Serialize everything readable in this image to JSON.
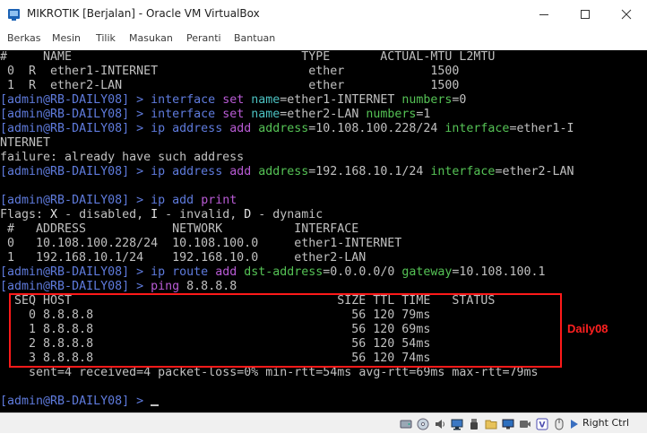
{
  "window": {
    "title": "MIKROTIK [Berjalan] - Oracle VM VirtualBox",
    "menu": [
      "Berkas",
      "Mesin",
      "Tilik",
      "Masukan",
      "Peranti",
      "Bantuan"
    ]
  },
  "terminal": {
    "lines": [
      [
        [
          "#     NAME                                TYPE       ACTUAL-MTU L2MTU",
          "w"
        ]
      ],
      [
        [
          " 0  R  ether1-INTERNET                     ether            1500",
          "w"
        ]
      ],
      [
        [
          " 1  R  ether2-LAN                          ether            1500",
          "w"
        ]
      ],
      [
        [
          "[admin@",
          "blue"
        ],
        [
          "RB-DAILY08",
          "blue"
        ],
        [
          "] > ",
          "blue"
        ],
        [
          "interface ",
          "blue"
        ],
        [
          "set ",
          "mag"
        ],
        [
          "name",
          "cyan"
        ],
        [
          "=ether1-INTERNET ",
          "w"
        ],
        [
          "numbers",
          "green"
        ],
        [
          "=0",
          "w"
        ]
      ],
      [
        [
          "[admin@",
          "blue"
        ],
        [
          "RB-DAILY08",
          "blue"
        ],
        [
          "] > ",
          "blue"
        ],
        [
          "interface ",
          "blue"
        ],
        [
          "set ",
          "mag"
        ],
        [
          "name",
          "cyan"
        ],
        [
          "=ether2-LAN ",
          "w"
        ],
        [
          "numbers",
          "green"
        ],
        [
          "=1",
          "w"
        ]
      ],
      [
        [
          "[admin@",
          "blue"
        ],
        [
          "RB-DAILY08",
          "blue"
        ],
        [
          "] > ",
          "blue"
        ],
        [
          "ip address ",
          "blue"
        ],
        [
          "add ",
          "mag"
        ],
        [
          "address",
          "green"
        ],
        [
          "=10.108.100.228/24 ",
          "w"
        ],
        [
          "interface",
          "green"
        ],
        [
          "=ether1-I",
          "w"
        ]
      ],
      [
        [
          "NTERNET",
          "w"
        ]
      ],
      [
        [
          "failure: already have such address",
          "w"
        ]
      ],
      [
        [
          "[admin@",
          "blue"
        ],
        [
          "RB-DAILY08",
          "blue"
        ],
        [
          "] > ",
          "blue"
        ],
        [
          "ip address ",
          "blue"
        ],
        [
          "add ",
          "mag"
        ],
        [
          "address",
          "green"
        ],
        [
          "=192.168.10.1/24 ",
          "w"
        ],
        [
          "interface",
          "green"
        ],
        [
          "=ether2-LAN",
          "w"
        ]
      ],
      [
        [
          "",
          "w"
        ]
      ],
      [
        [
          "[admin@",
          "blue"
        ],
        [
          "RB-DAILY08",
          "blue"
        ],
        [
          "] > ",
          "blue"
        ],
        [
          "ip add ",
          "blue"
        ],
        [
          "print",
          "mag"
        ]
      ],
      [
        [
          "Flags: ",
          "w"
        ],
        [
          "X",
          "hi"
        ],
        [
          " - disabled, ",
          "w"
        ],
        [
          "I",
          "hi"
        ],
        [
          " - invalid, ",
          "w"
        ],
        [
          "D",
          "hi"
        ],
        [
          " - dynamic",
          "w"
        ]
      ],
      [
        [
          " #   ADDRESS            NETWORK          INTERFACE",
          "w"
        ]
      ],
      [
        [
          " 0   10.108.100.228/24  10.108.100.0     ether1-INTERNET",
          "w"
        ]
      ],
      [
        [
          " 1   192.168.10.1/24    192.168.10.0     ether2-LAN",
          "w"
        ]
      ],
      [
        [
          "[admin@",
          "blue"
        ],
        [
          "RB-DAILY08",
          "blue"
        ],
        [
          "] > ",
          "blue"
        ],
        [
          "ip route ",
          "blue"
        ],
        [
          "add ",
          "mag"
        ],
        [
          "dst-address",
          "green"
        ],
        [
          "=0.0.0.0/0 ",
          "w"
        ],
        [
          "gateway",
          "green"
        ],
        [
          "=10.108.100.1",
          "w"
        ]
      ],
      [
        [
          "[admin@",
          "blue"
        ],
        [
          "RB-DAILY08",
          "blue"
        ],
        [
          "] > ",
          "blue"
        ],
        [
          "ping ",
          "mag"
        ],
        [
          "8.8.8.8",
          "w"
        ]
      ],
      [
        [
          "  SEQ HOST                                     SIZE TTL TIME   STATUS",
          "w"
        ]
      ],
      [
        [
          "    0 8.8.8.8                                    56 120 79ms",
          "w"
        ]
      ],
      [
        [
          "    1 8.8.8.8                                    56 120 69ms",
          "w"
        ]
      ],
      [
        [
          "    2 8.8.8.8                                    56 120 54ms",
          "w"
        ]
      ],
      [
        [
          "    3 8.8.8.8                                    56 120 74ms",
          "w"
        ]
      ],
      [
        [
          "    sent=4 ",
          "w"
        ],
        [
          "received",
          "w"
        ],
        [
          "=4 ",
          "w"
        ],
        [
          "packet-loss",
          "w"
        ],
        [
          "=0% ",
          "w"
        ],
        [
          "min-rtt",
          "w"
        ],
        [
          "=54ms ",
          "w"
        ],
        [
          "avg-rtt",
          "w"
        ],
        [
          "=69ms ",
          "w"
        ],
        [
          "max-rtt",
          "w"
        ],
        [
          "=79ms",
          "w"
        ]
      ],
      [
        [
          "",
          "w"
        ]
      ],
      [
        [
          "[admin@",
          "blue"
        ],
        [
          "RB-DAILY08",
          "blue"
        ],
        [
          "] > ",
          "blue"
        ]
      ]
    ]
  },
  "annotation": {
    "label": "Daily08",
    "color": "#ff1a1a"
  },
  "statusbar": {
    "host_key": "Right Ctrl",
    "icons": [
      "hard-disk-icon",
      "optical-drive-icon",
      "audio-icon",
      "network-icon",
      "usb-icon",
      "shared-folder-icon",
      "display-icon",
      "video-capture-icon",
      "recording-icon",
      "virtualization-icon",
      "mouse-integration-icon",
      "host-key-arrow-icon"
    ]
  },
  "colors": {
    "terminal_bg": "#000000",
    "prompt_blue": "#5f7bdd",
    "command_magenta": "#b95bd5",
    "param_green": "#55c255",
    "annotation_red": "#ff1a1a"
  }
}
